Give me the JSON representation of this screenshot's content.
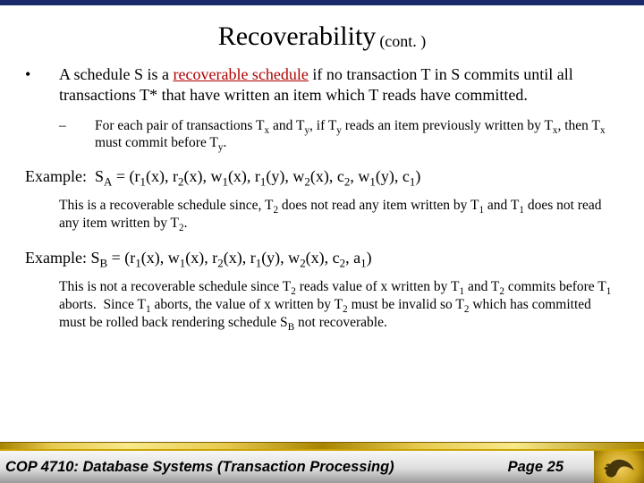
{
  "title": {
    "main": "Recoverability",
    "cont": "(cont. )"
  },
  "defn": {
    "pre": "A schedule S is a ",
    "term": "recoverable schedule",
    "post": " if no transaction T in S commits until all transactions T* that have written an item which T reads have committed."
  },
  "subrule": "For each pair of transactions T<sub>x</sub> and T<sub>y</sub>, if T<sub>y</sub> reads an item previously written by T<sub>x</sub>, then T<sub>x</sub> must commit before T<sub>y</sub>.",
  "exA": {
    "line": "Example:&nbsp;&nbsp;S<sub>A</sub> = (r<sub>1</sub>(x), r<sub>2</sub>(x), w<sub>1</sub>(x), r<sub>1</sub>(y), w<sub>2</sub>(x), c<sub>2</sub>, w<sub>1</sub>(y), c<sub>1</sub>)",
    "explain": "This is a recoverable schedule since, T<sub>2</sub> does not read any item written by T<sub>1</sub> and T<sub>1</sub> does not read any item written by T<sub>2</sub>."
  },
  "exB": {
    "line": "Example: S<sub>B</sub> = (r<sub>1</sub>(x), w<sub>1</sub>(x), r<sub>2</sub>(x), r<sub>1</sub>(y), w<sub>2</sub>(x), c<sub>2</sub>, a<sub>1</sub>)",
    "explain": "This is not a recoverable schedule since T<sub>2</sub> reads value of x written by T<sub>1</sub> and T<sub>2</sub> commits before T<sub>1</sub> aborts.&nbsp;&nbsp;Since T<sub>1</sub> aborts, the value of x written by T<sub>2</sub> must be invalid so T<sub>2</sub> which has committed must be rolled back rendering schedule S<sub>B</sub> not recoverable."
  },
  "footer": {
    "left": "COP 4710: Database Systems  (Transaction Processing)",
    "right": "Page 25"
  }
}
